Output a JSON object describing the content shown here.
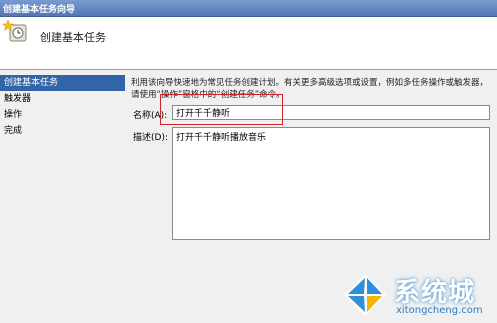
{
  "window": {
    "title": "创建基本任务向导"
  },
  "header": {
    "title": "创建基本任务",
    "icon": "task-wizard-icon"
  },
  "nav": {
    "items": [
      {
        "label": "创建基本任务",
        "active": true
      },
      {
        "label": "触发器",
        "active": false
      },
      {
        "label": "操作",
        "active": false
      },
      {
        "label": "完成",
        "active": false
      }
    ]
  },
  "content": {
    "description": "利用该向导快速地为常见任务创建计划。有关更多高级选项或设置，例如多任务操作或触发器，请使用“操作”窗格中的“创建任务”命令。",
    "name_label": "名称(A):",
    "name_value": "打开千千静听",
    "desc_label": "描述(D):",
    "desc_value": "打开千千静听播放音乐"
  },
  "watermark": {
    "brand": "系统城",
    "domain": "xitongcheng.com"
  },
  "colors": {
    "accent": "#3264a8",
    "highlight": "#d2232a",
    "titlebar": "#5377b3"
  }
}
